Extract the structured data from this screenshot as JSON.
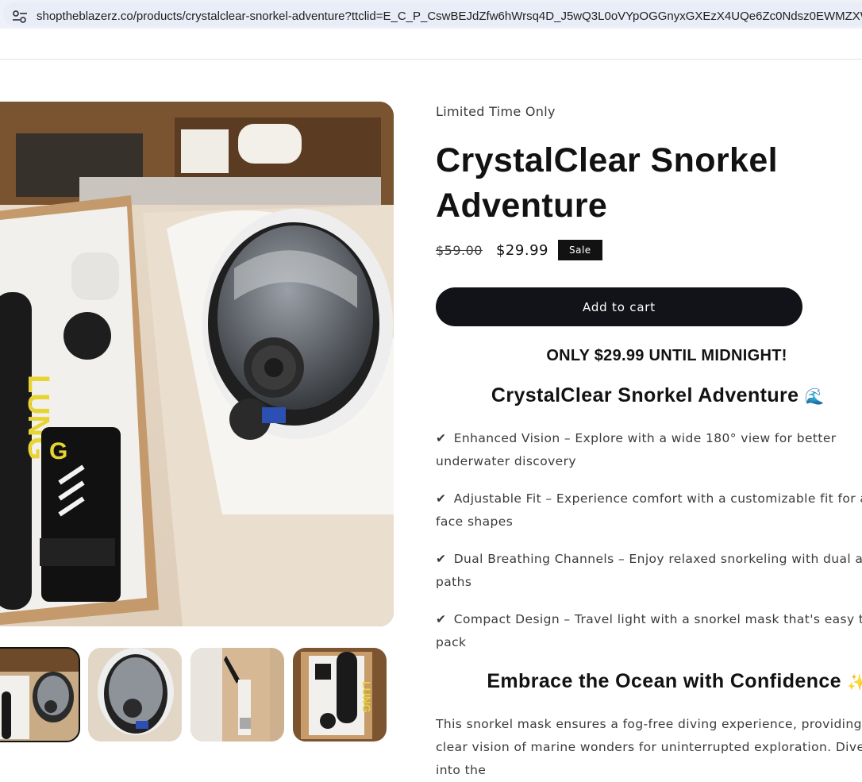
{
  "browser": {
    "url_domain": "shoptheblazerz.co",
    "url_path": "/products/crystalclear-snorkel-adventure?ttclid=E_C_P_CswBEJdZfw6hWrsq4D_J5wQ3L0oVYpOGGnyxGXEzX4UQe6Zc0Ndsz0EWMZXWC",
    "site_info_icon": "tune-icon"
  },
  "product": {
    "eyebrow": "Limited Time Only",
    "title_line1": "CrystalClear Snorkel",
    "title_line2": "Adventure",
    "price_regular": "$59.00",
    "price_sale": "$29.99",
    "sale_badge": "Sale",
    "add_to_cart": "Add to cart",
    "promo": "ONLY $29.99 UNTIL MIDNIGHT!"
  },
  "description": {
    "heading": "CrystalClear Snorkel Adventure",
    "heading_emoji": "🌊",
    "check": "✔",
    "features": [
      {
        "name": "Enhanced Vision",
        "text": " – Explore with a wide 180° view for better underwater discovery"
      },
      {
        "name": "Adjustable Fit",
        "text": " – Experience comfort with a customizable fit for all face shapes"
      },
      {
        "name": "Dual Breathing Channels",
        "text": " – Enjoy relaxed snorkeling with dual air paths"
      },
      {
        "name": "Compact Design",
        "text": " – Travel light with a snorkel mask that's easy to pack"
      }
    ],
    "heading2": "Embrace the Ocean with Confidence",
    "heading2_emoji": "✨",
    "body": "This snorkel mask ensures a fog-free diving experience, providing clear vision of marine wonders for uninterrupted exploration. Dive into the"
  },
  "media": {
    "main_image": "product-photo-mask-in-box",
    "thumbnails": [
      "thumb-box-overview",
      "thumb-mask-front",
      "thumb-box-side",
      "thumb-tank-closeup"
    ]
  },
  "colors": {
    "accent": "#121212",
    "text": "#3b3b3b",
    "url_bar": "#e9edf7"
  }
}
